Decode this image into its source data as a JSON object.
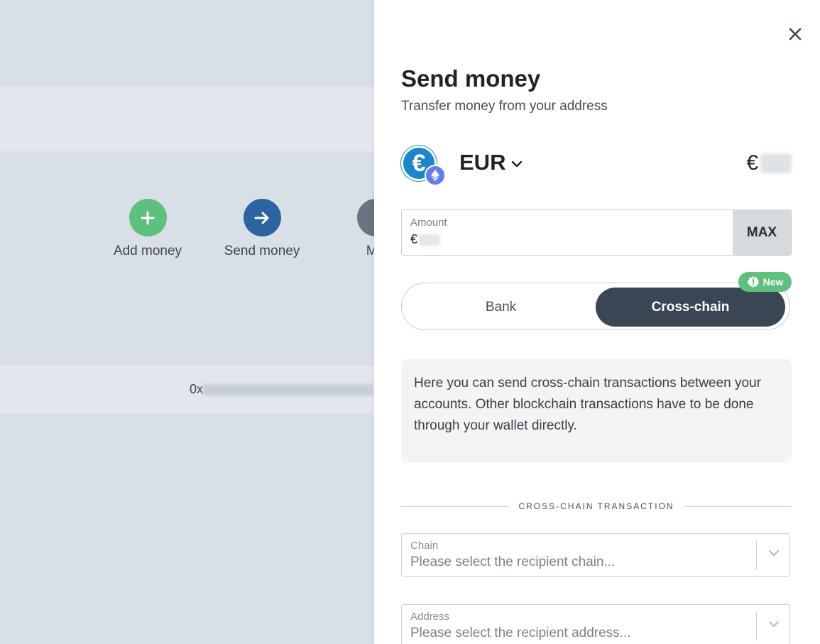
{
  "background": {
    "actions": [
      {
        "label": "Add money",
        "icon": "plus-icon",
        "color": "#5fbf7e"
      },
      {
        "label": "Send money",
        "icon": "arrow-right-icon",
        "color": "#2b64a0"
      },
      {
        "label": "Mo",
        "icon": "more-icon",
        "color": "#6b7280"
      }
    ],
    "address_prefix": "0x"
  },
  "panel": {
    "title": "Send money",
    "subtitle": "Transfer money from your address",
    "currency": {
      "code": "EUR",
      "symbol": "€",
      "coin_icon": "euro-coin-icon",
      "network_icon": "ethereum-icon"
    },
    "balance_symbol": "€",
    "amount": {
      "label": "Amount",
      "symbol": "€",
      "max_label": "MAX"
    },
    "tabs": {
      "bank_label": "Bank",
      "cross_chain_label": "Cross-chain",
      "active": "cross_chain",
      "new_badge": "New"
    },
    "info_text": "Here you can send cross-chain transactions between your accounts. Other blockchain transactions have to be done through your wallet directly.",
    "section_title": "CROSS-CHAIN TRANSACTION",
    "chain_field": {
      "label": "Chain",
      "placeholder": "Please select the recipient chain..."
    },
    "address_field": {
      "label": "Address",
      "placeholder": "Please select the recipient address..."
    }
  },
  "colors": {
    "accent_dark": "#3a4654",
    "success": "#5fbf7e",
    "primary_blue": "#2b64a0",
    "euro_blue": "#1b87c8",
    "eth_purple": "#627eea"
  }
}
